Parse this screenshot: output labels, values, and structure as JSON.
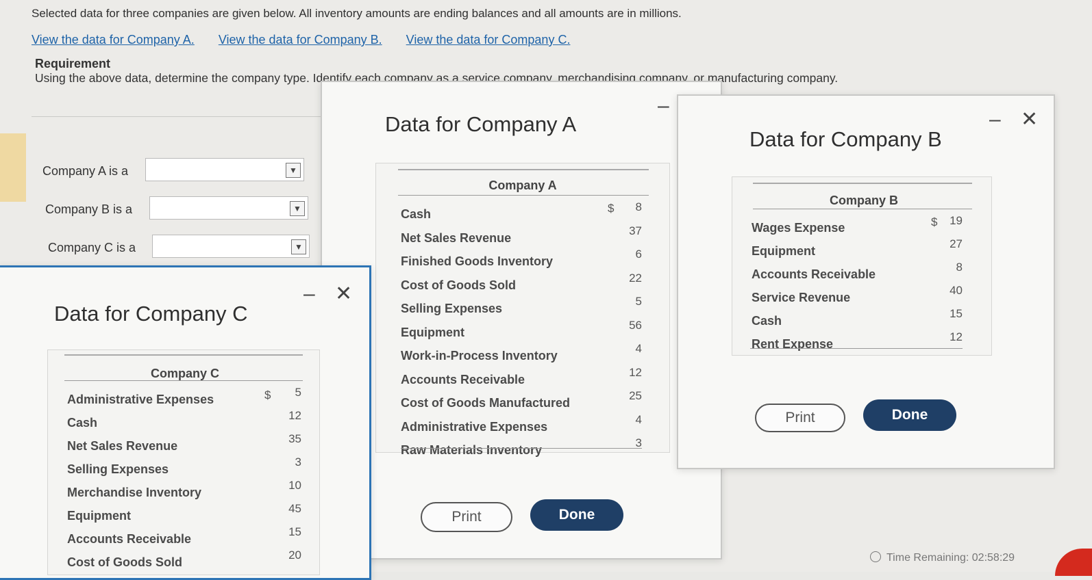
{
  "intro": "Selected data for three companies are given below. All inventory amounts are ending balances and all amounts are in millions.",
  "links": [
    "View the data for Company A.",
    "View the data for Company B.",
    "View the data for Company C."
  ],
  "requirement": {
    "title": "Requirement",
    "text": "Using the above data, determine the company type. Identify each company as a service company, merchandising company, or manufacturing company."
  },
  "questions": [
    {
      "label": "Company A is a",
      "value": ""
    },
    {
      "label": "Company B is a",
      "value": ""
    },
    {
      "label": "Company C is a",
      "value": ""
    }
  ],
  "dropdown_icon": "▼",
  "window_controls": {
    "minimize": "–",
    "close": "✕"
  },
  "modal_a": {
    "title": "Data for Company A",
    "header": "Company A",
    "currency": "$",
    "rows": [
      {
        "label": "Cash",
        "value": "8"
      },
      {
        "label": "Net Sales Revenue",
        "value": "37"
      },
      {
        "label": "Finished Goods Inventory",
        "value": "6"
      },
      {
        "label": "Cost of Goods Sold",
        "value": "22"
      },
      {
        "label": "Selling Expenses",
        "value": "5"
      },
      {
        "label": "Equipment",
        "value": "56"
      },
      {
        "label": "Work-in-Process Inventory",
        "value": "4"
      },
      {
        "label": "Accounts Receivable",
        "value": "12"
      },
      {
        "label": "Cost of Goods Manufactured",
        "value": "25"
      },
      {
        "label": "Administrative Expenses",
        "value": "4"
      },
      {
        "label": "Raw Materials Inventory",
        "value": "3"
      }
    ],
    "print_label": "Print",
    "done_label": "Done"
  },
  "modal_b": {
    "title": "Data for Company B",
    "header": "Company B",
    "currency": "$",
    "rows": [
      {
        "label": "Wages Expense",
        "value": "19"
      },
      {
        "label": "Equipment",
        "value": "27"
      },
      {
        "label": "Accounts Receivable",
        "value": "8"
      },
      {
        "label": "Service Revenue",
        "value": "40"
      },
      {
        "label": "Cash",
        "value": "15"
      },
      {
        "label": "Rent Expense",
        "value": "12"
      }
    ],
    "print_label": "Print",
    "done_label": "Done"
  },
  "modal_c": {
    "title": "Data for Company C",
    "header": "Company C",
    "currency": "$",
    "rows": [
      {
        "label": "Administrative Expenses",
        "value": "5"
      },
      {
        "label": "Cash",
        "value": "12"
      },
      {
        "label": "Net Sales Revenue",
        "value": "35"
      },
      {
        "label": "Selling Expenses",
        "value": "3"
      },
      {
        "label": "Merchandise Inventory",
        "value": "10"
      },
      {
        "label": "Equipment",
        "value": "45"
      },
      {
        "label": "Accounts Receivable",
        "value": "15"
      },
      {
        "label": "Cost of Goods Sold",
        "value": "20"
      }
    ]
  },
  "time_remaining": "Time Remaining: 02:58:29",
  "colors": {
    "link": "#1e63a8",
    "done_button": "#1f3f66",
    "active_border": "#2d74b5"
  }
}
